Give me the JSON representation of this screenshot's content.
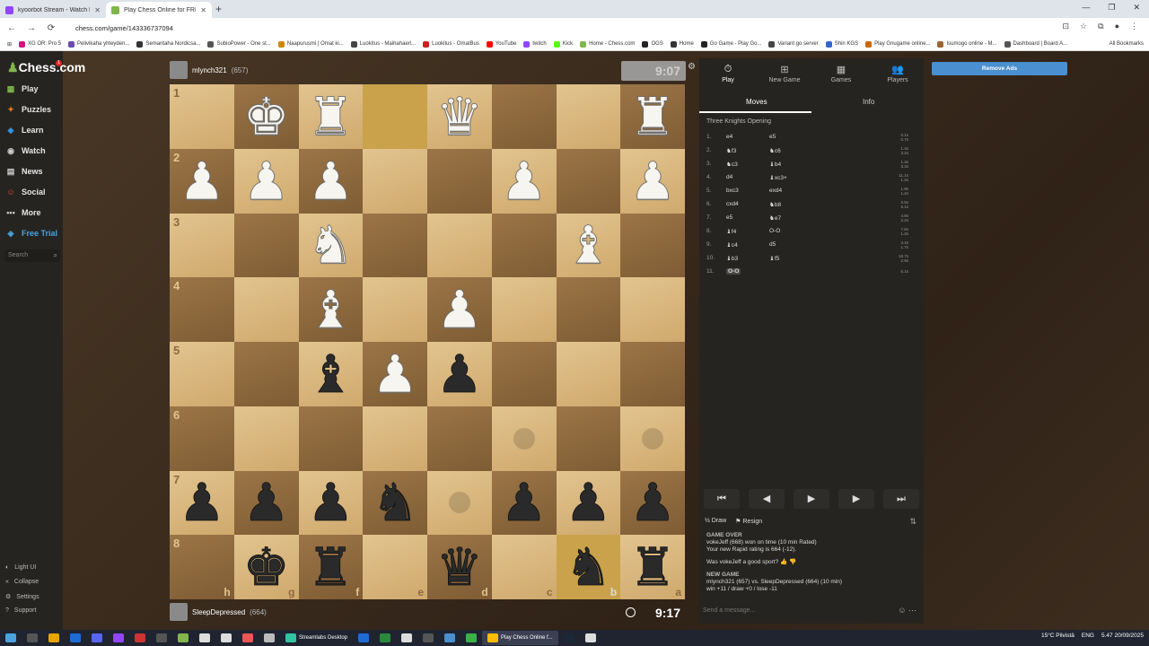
{
  "browser": {
    "tabs": [
      {
        "label": "kyoorbot Stream - Watch li",
        "color": "#9146ff",
        "active": false
      },
      {
        "label": "Play Chess Online for FREE - 2 ",
        "color": "#81b64c",
        "active": true
      }
    ],
    "new_tab": "+",
    "url": "chess.com/game/143336737094",
    "window_controls": [
      "—",
      "❐",
      "✕"
    ],
    "nav": [
      "←",
      "→",
      "⟳"
    ],
    "bookmarks": [
      {
        "label": "XG OR: Pro 5",
        "color": "#d4147a"
      },
      {
        "label": "Pelivikaha yhteyden...",
        "color": "#6a4caf"
      },
      {
        "label": "Semantaha Nordicsa...",
        "color": "#333333"
      },
      {
        "label": "SubioPower - One st...",
        "color": "#555555"
      },
      {
        "label": "Naapurusmi | Omat ki...",
        "color": "#cc8800"
      },
      {
        "label": "Luokitus - Maihahaerl...",
        "color": "#444444"
      },
      {
        "label": "Luokitus - OmatBus",
        "color": "#cc2222"
      },
      {
        "label": "YouTube",
        "color": "#ff0000"
      },
      {
        "label": "twitch",
        "color": "#9146ff"
      },
      {
        "label": "Kick",
        "color": "#53fc18"
      },
      {
        "label": "Home - Chess.com",
        "color": "#81b64c"
      },
      {
        "label": "OGS",
        "color": "#222222"
      },
      {
        "label": "Home",
        "color": "#333333"
      },
      {
        "label": "Go Game - Play Go...",
        "color": "#222222"
      },
      {
        "label": "Variant go server",
        "color": "#444444"
      },
      {
        "label": "Shin KGS",
        "color": "#3366cc"
      },
      {
        "label": "Play Gnugame online...",
        "color": "#cc6600"
      },
      {
        "label": "Isumogo online - M...",
        "color": "#996633"
      },
      {
        "label": "Dashboard | Board A...",
        "color": "#555555"
      }
    ],
    "all_bookmarks": "All Bookmarks"
  },
  "sidebar": {
    "logo": "Chess.com",
    "logo_badge": "1",
    "items": [
      {
        "label": "Play",
        "icon": "board-icon",
        "color": "#81b64c"
      },
      {
        "label": "Puzzles",
        "icon": "puzzle-icon",
        "color": "#e8771c"
      },
      {
        "label": "Learn",
        "icon": "learn-icon",
        "color": "#3b8fd9"
      },
      {
        "label": "Watch",
        "icon": "binoculars-icon",
        "color": "#cccccc"
      },
      {
        "label": "News",
        "icon": "news-icon",
        "color": "#cccccc"
      },
      {
        "label": "Social",
        "icon": "social-icon",
        "color": "#e04a3a"
      },
      {
        "label": "More",
        "icon": "more-icon",
        "color": "#cccccc"
      },
      {
        "label": "Free Trial",
        "icon": "diamond-icon",
        "color": "#4aa3df"
      }
    ],
    "search_placeholder": "Search",
    "bottom": [
      "Light UI",
      "Collapse",
      "Settings",
      "Support"
    ]
  },
  "top_player": {
    "name": "mlynch321",
    "rating": "(657)",
    "clock": "9:07"
  },
  "bottom_player": {
    "name": "SleepDepressed",
    "rating": "(664)",
    "clock": "9:17"
  },
  "board": {
    "orientation": "black",
    "ranks": [
      "1",
      "2",
      "3",
      "4",
      "5",
      "6",
      "7",
      "8"
    ],
    "files": [
      "h",
      "g",
      "f",
      "e",
      "d",
      "c",
      "b",
      "a"
    ],
    "rows": [
      [
        "",
        "wK",
        "wR",
        "",
        "wQ",
        "",
        "",
        "wR"
      ],
      [
        "wP",
        "wP",
        "wP",
        "",
        "",
        "wP",
        "",
        "wP"
      ],
      [
        "",
        "",
        "wN",
        "",
        "",
        "",
        "wB",
        ""
      ],
      [
        "",
        "",
        "wB",
        "",
        "wP",
        "",
        "",
        ""
      ],
      [
        "",
        "",
        "bB",
        "wP",
        "bP",
        "",
        "",
        ""
      ],
      [
        "",
        "",
        "",
        "",
        "",
        "",
        "",
        ""
      ],
      [
        "bP",
        "bP",
        "bP",
        "bN",
        "",
        "bP",
        "bP",
        "bP"
      ],
      [
        "",
        "bK",
        "bR",
        "",
        "bQ",
        "",
        "bN",
        "bR"
      ]
    ],
    "highlights": [
      [
        0,
        3
      ],
      [
        7,
        6
      ]
    ],
    "move_dots": [
      [
        5,
        5
      ],
      [
        5,
        7
      ],
      [
        6,
        4
      ]
    ]
  },
  "panel": {
    "tabs": [
      {
        "label": "Play",
        "icon": "clock-icon"
      },
      {
        "label": "New Game",
        "icon": "plus-icon"
      },
      {
        "label": "Games",
        "icon": "grid-icon"
      },
      {
        "label": "Players",
        "icon": "players-icon"
      }
    ],
    "subtabs": [
      "Moves",
      "Info"
    ],
    "opening": "Three Knights Opening",
    "moves": [
      {
        "n": "1.",
        "w": "e4",
        "b": "e5",
        "wt": "0.1s",
        "bt": "0.7s"
      },
      {
        "n": "2.",
        "w": "♞f3",
        "b": "♞c6",
        "wt": "1.4s",
        "bt": "3.2s"
      },
      {
        "n": "3.",
        "w": "♞c3",
        "b": "♝b4",
        "wt": "1.3s",
        "bt": "3.3s"
      },
      {
        "n": "4.",
        "w": "d4",
        "b": "♝xc3+",
        "wt": "11.1s",
        "bt": "1.2s"
      },
      {
        "n": "5.",
        "w": "bxc3",
        "b": "exd4",
        "wt": "1.9s",
        "bt": "1.2s"
      },
      {
        "n": "6.",
        "w": "cxd4",
        "b": "♞b8",
        "wt": "2.5s",
        "bt": "6.1s"
      },
      {
        "n": "7.",
        "w": "e5",
        "b": "♞e7",
        "wt": "4.8s",
        "bt": "2.2s"
      },
      {
        "n": "8.",
        "w": "♝f4",
        "b": "O-O",
        "wt": "7.6s",
        "bt": "1.2s"
      },
      {
        "n": "9.",
        "w": "♝c4",
        "b": "d5",
        "wt": "3.4s",
        "bt": "1.7s"
      },
      {
        "n": "10.",
        "w": "♝b3",
        "b": "♝f5",
        "wt": "18.7s",
        "bt": "2.9s"
      },
      {
        "n": "11.",
        "w": "O-O",
        "b": "",
        "wt": "6.1s",
        "bt": ""
      }
    ],
    "controls": [
      "⏮",
      "◀",
      "▶",
      "▶",
      "⏭"
    ],
    "draw": "Draw",
    "resign": "Resign",
    "chat": {
      "game_over": "GAME OVER",
      "result": "vokeJeff (668) won on time (10 min Rated)",
      "rating": "Your new Rapid rating is 664 (-12).",
      "sport": "Was vokeJeff a good sport?",
      "new_game": "NEW GAME",
      "match": "mlynch321 (657) vs. SleepDepressed (664) (10 min)",
      "record": "win +11 / draw +0 / lose -11"
    },
    "chat_placeholder": "Send a message..."
  },
  "remove_ads": "Remove Ads",
  "taskbar": {
    "apps": [
      {
        "label": "Streamlabs Desktop",
        "active": false
      },
      {
        "label": "Play Chess Online f...",
        "active": true
      }
    ],
    "weather": "15°C Pilvistä",
    "lang": "ENG",
    "time": "5.47",
    "date": "20/09/2025"
  }
}
